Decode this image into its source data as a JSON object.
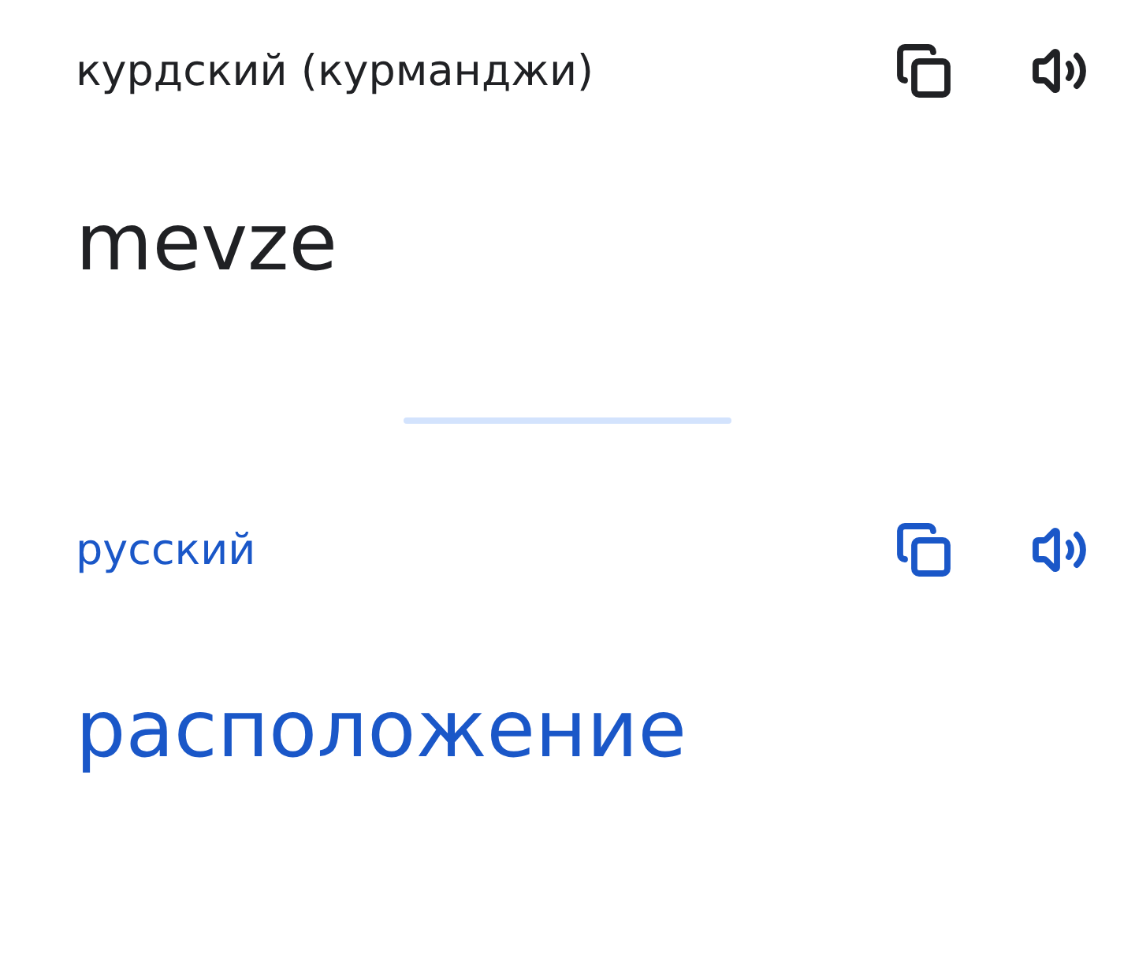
{
  "panels": [
    {
      "kind": "source",
      "language": "курдский (курманджи)",
      "text": "mevze"
    },
    {
      "kind": "target",
      "language": "русский",
      "text": "расположение"
    }
  ]
}
